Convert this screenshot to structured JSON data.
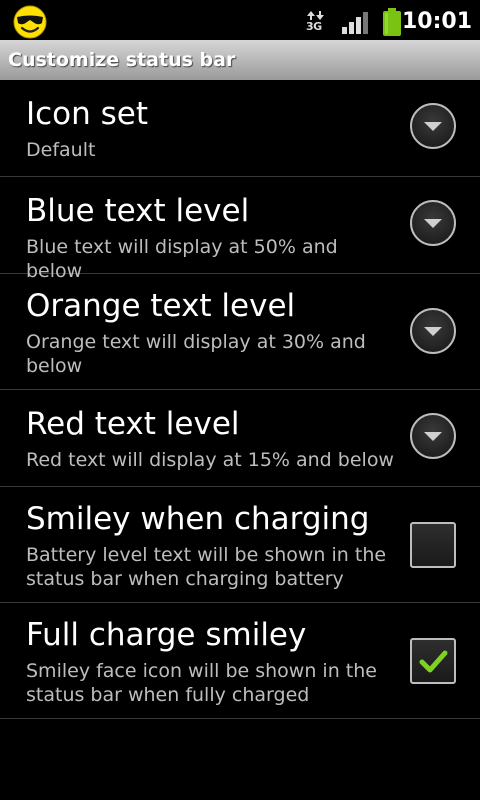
{
  "status_bar": {
    "network_type": "3G",
    "time": "10:01",
    "battery_color": "#7bc313"
  },
  "title_bar": {
    "title": "Customize status bar"
  },
  "settings": [
    {
      "title": "Icon set",
      "summary": "Default",
      "control": "dropdown",
      "icon": "chevron-down-icon"
    },
    {
      "title": "Blue text level",
      "summary": "Blue text will display at 50% and below",
      "control": "dropdown",
      "icon": "chevron-down-icon"
    },
    {
      "title": "Orange text level",
      "summary": "Orange text will display at 30% and below",
      "control": "dropdown",
      "icon": "chevron-down-icon"
    },
    {
      "title": "Red text level",
      "summary": "Red text will display at 15% and below",
      "control": "dropdown",
      "icon": "chevron-down-icon"
    },
    {
      "title": "Smiley when charging",
      "summary": "Battery level text will be shown in the status bar when charging battery",
      "control": "checkbox",
      "checked": false
    },
    {
      "title": "Full charge smiley",
      "summary": "Smiley face icon will be shown in the status bar when fully charged",
      "control": "checkbox",
      "checked": true
    }
  ],
  "colors": {
    "accent_check": "#7ed321",
    "title_bar_top": "#d6d6d6",
    "title_bar_bottom": "#9a9a9a"
  }
}
